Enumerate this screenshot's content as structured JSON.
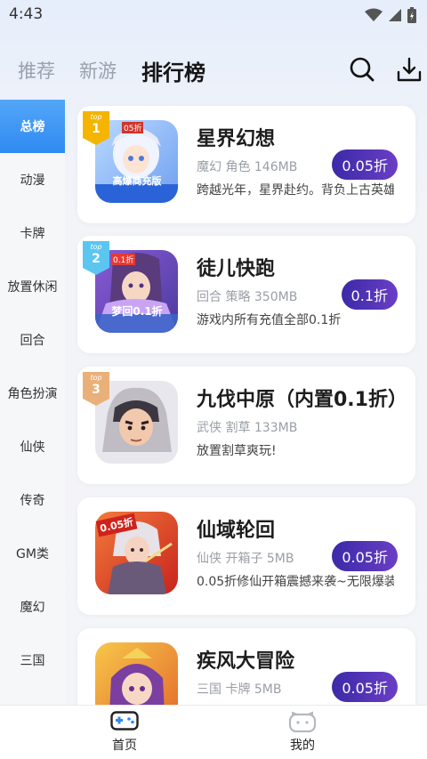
{
  "status": {
    "time": "4:43"
  },
  "top_tabs": [
    {
      "label": "推荐"
    },
    {
      "label": "新游"
    },
    {
      "label": "排行榜"
    }
  ],
  "categories": [
    {
      "label": "总榜"
    },
    {
      "label": "动漫"
    },
    {
      "label": "卡牌"
    },
    {
      "label": "放置休闲"
    },
    {
      "label": "回合"
    },
    {
      "label": "角色扮演"
    },
    {
      "label": "仙侠"
    },
    {
      "label": "传奇"
    },
    {
      "label": "GM类"
    },
    {
      "label": "魔幻"
    },
    {
      "label": "三国"
    }
  ],
  "games": [
    {
      "rank": "1",
      "badge_text": "top",
      "name": "星界幻想",
      "meta": "魔幻 角色 146MB",
      "desc": "跨越光年，星界赴约。背负上古英雄们的希望",
      "discount": "0.05折",
      "thumb_text": "高爆商充版",
      "thumb_tag": "05折"
    },
    {
      "rank": "2",
      "badge_text": "top",
      "name": "徒儿快跑",
      "meta": "回合 策略 350MB",
      "desc": "游戏内所有充值全部0.1折",
      "discount": "0.1折",
      "thumb_text": "梦回0.1折",
      "thumb_tag": "0.1折"
    },
    {
      "rank": "3",
      "badge_text": "top",
      "name": "九伐中原（内置0.1折）",
      "meta": "武侠 割草 133MB",
      "desc": "放置割草爽玩!",
      "discount": "",
      "thumb_text": "",
      "thumb_tag": ""
    },
    {
      "rank": "",
      "badge_text": "",
      "name": "仙域轮回",
      "meta": "仙侠 开箱子 5MB",
      "desc": "0.05折修仙开箱震撼来袭~无限爆装",
      "discount": "0.05折",
      "thumb_text": "",
      "thumb_tag": "0.05折"
    },
    {
      "rank": "",
      "badge_text": "",
      "name": "疾风大冒险",
      "meta": "三国 卡牌 5MB",
      "desc": "",
      "discount": "0.05折",
      "thumb_text": "",
      "thumb_tag": ""
    }
  ],
  "bottom_nav": [
    {
      "label": "首页",
      "icon": "gamepad-icon"
    },
    {
      "label": "我的",
      "icon": "profile-icon"
    }
  ],
  "colors": {
    "accent_blue": "#2f8bf2",
    "discount_start": "#3b2aa8",
    "discount_end": "#6a3ec5",
    "badge_gold": "#f5b400",
    "badge_blue": "#5bc6f0",
    "badge_bronze": "#e9b07a"
  }
}
